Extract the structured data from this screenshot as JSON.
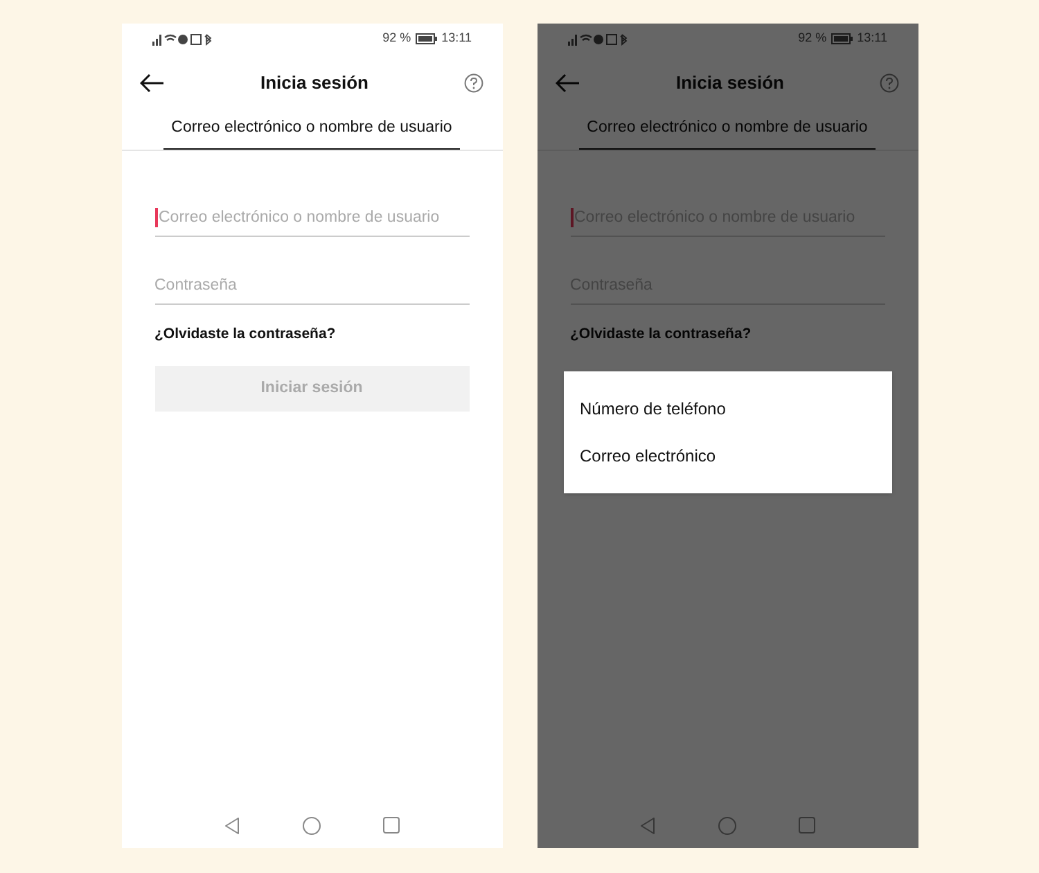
{
  "screens": [
    {
      "status_bar": {
        "battery": "92 %",
        "time": "13:11"
      },
      "title": "Inicia sesión",
      "tab": {
        "label": "Correo electrónico o nombre de usuario",
        "selected": true
      },
      "email_field": {
        "placeholder": "Correo electrónico o nombre de usuario",
        "focused": true
      },
      "password_field": {
        "placeholder": "Contraseña"
      },
      "forgot_link": "¿Olvidaste la contraseña?",
      "login_button": {
        "label": "Iniciar sesión",
        "disabled": true
      },
      "dimmed": false
    },
    {
      "status_bar": {
        "battery": "92 %",
        "time": "13:11"
      },
      "title": "Inicia sesión",
      "tab": {
        "label": "Correo electrónico o nombre de usuario",
        "selected": true
      },
      "email_field": {
        "placeholder": "Correo electrónico o nombre de usuario",
        "focused": true
      },
      "password_field": {
        "placeholder": "Contraseña"
      },
      "forgot_link": "¿Olvidaste la contraseña?",
      "dimmed": true,
      "menu": {
        "items": [
          "Número de teléfono",
          "Correo electrónico"
        ]
      }
    }
  ]
}
